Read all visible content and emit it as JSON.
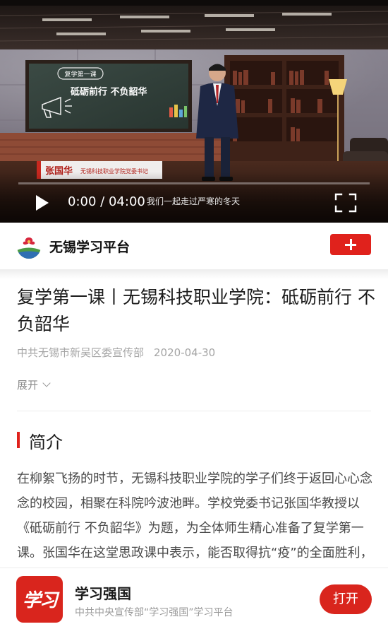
{
  "video": {
    "board_tag": "复学第一课",
    "board_title": "砥砺前行 不负韶华",
    "lower_third_name": "张国华",
    "lower_third_role": "无锡科技职业学院党委书记",
    "current_time": "0:00",
    "separator": "/",
    "duration": "04:00",
    "subtitle": "我们一起走过严寒的冬天",
    "progress": 0
  },
  "publisher": {
    "name": "无锡学习平台",
    "logo_icon": "publisher-logo-icon",
    "follow_icon": "plus-icon"
  },
  "article": {
    "title": "复学第一课丨无锡科技职业学院：砥砺前行 不负韶华",
    "source": "中共无锡市新吴区委宣传部",
    "date": "2020-04-30",
    "expand_label": "展开",
    "section_title": "简介",
    "intro": "在柳絮飞扬的时节，无锡科技职业学院的学子们终于返回心心念念的校园，相聚在科院吟波池畔。学校党委书记张国华教授以《砥砺前行 不负韶华》为题，为全体师生精心准备了复学第一课。张国华在这堂思政课中表示，能否取得抗“疫”的全面胜利，取决于全体师生携手"
  },
  "app_banner": {
    "icon_text": "学习",
    "name": "学习强国",
    "description": "中共中央宣传部“学习强国”学习平台",
    "open_label": "打开"
  },
  "colors": {
    "accent": "#e0221c",
    "text": "#1b1b1b",
    "muted": "#a5a5a5"
  }
}
